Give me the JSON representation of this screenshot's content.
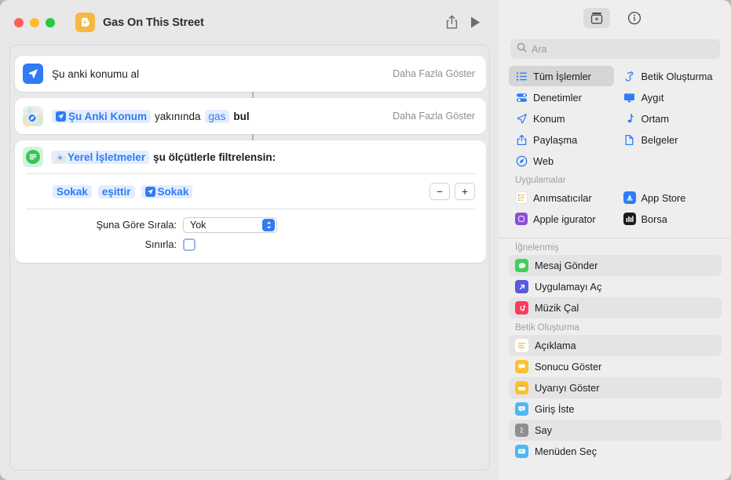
{
  "window": {
    "title": "Gas On This Street",
    "app_icon": "shortcuts-gas-icon",
    "traffic_lights": [
      "close",
      "minimize",
      "zoom"
    ],
    "share_label": "share-icon",
    "run_label": "play-icon"
  },
  "workflow": {
    "actions": [
      {
        "icon": "location-arrow-icon",
        "label": "Şu anki konumu al",
        "more_label": "Daha Fazla Göster"
      },
      {
        "icon": "maps-icon",
        "token_1": "Şu Anki Konum",
        "word_1": "yakınında",
        "token_2": "gas",
        "word_2": "bul",
        "more_label": "Daha Fazla Göster"
      }
    ],
    "filter_action": {
      "icon": "filter-icon",
      "source_token": "Yerel İşletmeler",
      "head_text": "şu ölçütlerle filtrelensin:",
      "condition": {
        "field": "Sokak",
        "operator": "eşittir",
        "value": "Sokak"
      },
      "remove_label": "−",
      "add_label": "+",
      "sort_label": "Şuna Göre Sırala:",
      "sort_value": "Yok",
      "limit_label": "Sınırla:",
      "limit_checked": false
    }
  },
  "sidebar": {
    "toolbar": {
      "library_icon": "action-library-icon",
      "info_icon": "info-circle-icon"
    },
    "search": {
      "placeholder": "Ara",
      "value": "",
      "icon": "search-icon"
    },
    "categories": [
      {
        "label": "Tüm İşlemler",
        "icon": "list-bullet-icon",
        "selected": true
      },
      {
        "label": "Betik Oluşturma",
        "icon": "script-icon",
        "selected": false
      },
      {
        "label": "Denetimler",
        "icon": "controls-icon",
        "selected": false
      },
      {
        "label": "Aygıt",
        "icon": "display-icon",
        "selected": false
      },
      {
        "label": "Konum",
        "icon": "location-arrow-icon",
        "selected": false
      },
      {
        "label": "Ortam",
        "icon": "music-note-icon",
        "selected": false
      },
      {
        "label": "Paylaşma",
        "icon": "share-icon",
        "selected": false
      },
      {
        "label": "Belgeler",
        "icon": "document-icon",
        "selected": false
      },
      {
        "label": "Web",
        "icon": "safari-compass-icon",
        "selected": false
      }
    ],
    "apps_section": {
      "title": "Uygulamalar",
      "items": [
        {
          "label": "Anımsatıcılar",
          "icon": "reminders-icon",
          "color": "#ffffff"
        },
        {
          "label": "App Store",
          "icon": "appstore-icon",
          "color": "#2f7cf6"
        },
        {
          "label": "Apple  igurator",
          "icon": "apple-configurator-icon",
          "color": "#8a4fd6"
        },
        {
          "label": "Borsa",
          "icon": "stocks-icon",
          "color": "#1c1c1e"
        }
      ]
    },
    "pinned_section": {
      "title": "İğnelenmiş",
      "items": [
        {
          "label": "Mesaj Gönder",
          "icon": "messages-icon",
          "color": "#3fd05a"
        },
        {
          "label": "Uygulamayı Aç",
          "icon": "open-app-icon",
          "color": "#5a5ae0"
        },
        {
          "label": "Müzik Çal",
          "icon": "music-icon",
          "color": "#fb3b5c"
        }
      ]
    },
    "scripting_section": {
      "title": "Betik Oluşturma",
      "items": [
        {
          "label": "Açıklama",
          "icon": "comment-icon",
          "color": "#ffffff"
        },
        {
          "label": "Sonucu Göster",
          "icon": "show-result-icon",
          "color": "#ffbf2e"
        },
        {
          "label": "Uyarıyı Göster",
          "icon": "show-alert-icon",
          "color": "#ffbf2e"
        },
        {
          "label": "Giriş İste",
          "icon": "ask-input-icon",
          "color": "#4cb8f5"
        },
        {
          "label": "Say",
          "icon": "count-sigma-icon",
          "color": "#8e8e93"
        },
        {
          "label": "Menüden Seç",
          "icon": "choose-menu-icon",
          "color": "#4cb8f5"
        }
      ]
    }
  },
  "colors": {
    "accent": "#2f7cf6",
    "token_bg": "#e3edfd",
    "window_bg": "#e8e8e8",
    "sidebar_bg": "#eeeeee"
  }
}
